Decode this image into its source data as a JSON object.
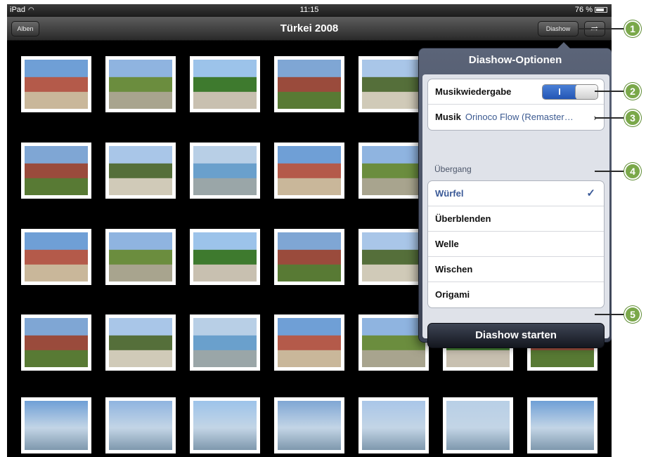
{
  "status_bar": {
    "carrier": "iPad",
    "time": "11:15",
    "battery": "76 %"
  },
  "nav_bar": {
    "back_label": "Alben",
    "title": "Türkei 2008",
    "slideshow_label": "Diashow",
    "share_icon": "share-icon"
  },
  "popover": {
    "title": "Diashow-Optionen",
    "music_playback_label": "Musikwiedergabe",
    "music_toggle_state": "I",
    "music_label": "Musik",
    "music_value": "Orinoco Flow (Remaster…",
    "transition_section": "Übergang",
    "transitions": [
      "Würfel",
      "Überblenden",
      "Welle",
      "Wischen",
      "Origami"
    ],
    "selected_transition": "Würfel",
    "start_label": "Diashow starten"
  },
  "callouts": [
    "1",
    "2",
    "3",
    "4",
    "5"
  ],
  "colors": {
    "accent": "#3a5997",
    "callout": "#7aa84a",
    "popover": "#4b5366"
  }
}
